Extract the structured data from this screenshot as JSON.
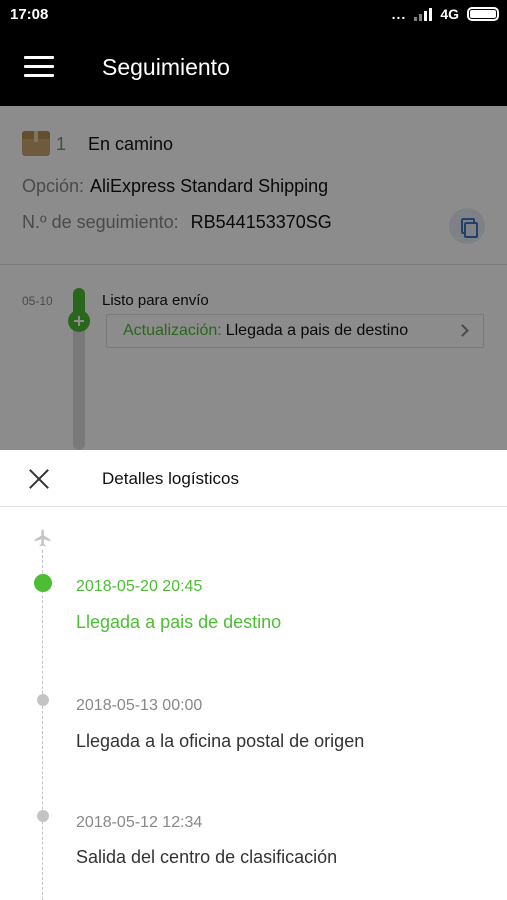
{
  "status_bar": {
    "time": "17:08",
    "dots": "...",
    "network": "4G"
  },
  "app_bar": {
    "title": "Seguimiento"
  },
  "package": {
    "count": "1",
    "status": "En camino",
    "option_label": "Opción:",
    "option_value": "AliExpress Standard Shipping",
    "tracking_label": "N.º de seguimiento:",
    "tracking_value": "RB544153370SG"
  },
  "timeline_preview": {
    "date": "05-10",
    "title": "Listo para envío",
    "update_label": "Actualización:",
    "update_value": "Llegada a pais de destino"
  },
  "sheet": {
    "title": "Detalles logísticos",
    "events": [
      {
        "date": "2018-05-20 20:45",
        "text": "Llegada a pais de destino"
      },
      {
        "date": "2018-05-13 00:00",
        "text": "Llegada a la oficina postal de origen"
      },
      {
        "date": "2018-05-12 12:34",
        "text": "Salida del centro de clasificación"
      }
    ]
  },
  "colors": {
    "accent_green": "#4cbe34",
    "appbar": "#000000"
  }
}
